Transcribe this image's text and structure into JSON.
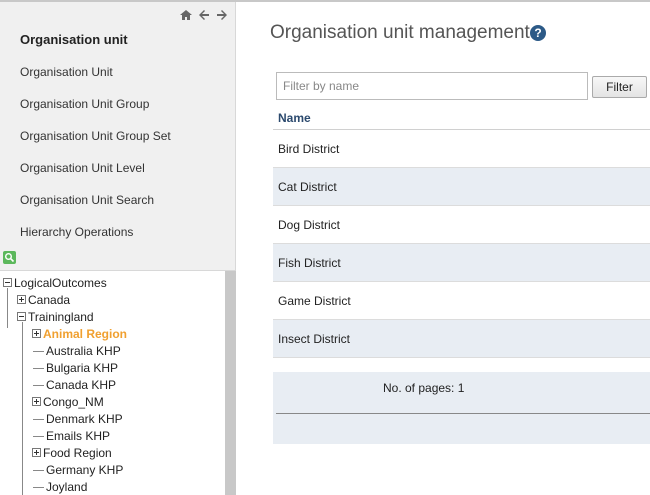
{
  "icons": {
    "home": "home-icon",
    "back": "arrow-left-icon",
    "forward": "arrow-right-icon",
    "search": "search-icon",
    "help": "help-icon"
  },
  "sidebar": {
    "title": "Organisation unit",
    "items": [
      {
        "label": "Organisation Unit"
      },
      {
        "label": "Organisation Unit Group"
      },
      {
        "label": "Organisation Unit Group Set"
      },
      {
        "label": "Organisation Unit Level"
      },
      {
        "label": "Organisation Unit Search"
      },
      {
        "label": "Hierarchy Operations"
      }
    ]
  },
  "tree": {
    "nodes": [
      {
        "label": "LogicalOutcomes",
        "toggle": "minus"
      },
      {
        "label": "Canada",
        "toggle": "plus"
      },
      {
        "label": "Trainingland",
        "toggle": "minus"
      },
      {
        "label": "Animal Region",
        "toggle": "plus",
        "selected": true
      },
      {
        "label": "Australia KHP"
      },
      {
        "label": "Bulgaria KHP"
      },
      {
        "label": "Canada KHP"
      },
      {
        "label": "Congo_NM",
        "toggle": "plus"
      },
      {
        "label": "Denmark KHP"
      },
      {
        "label": "Emails KHP"
      },
      {
        "label": "Food Region",
        "toggle": "plus"
      },
      {
        "label": "Germany KHP"
      },
      {
        "label": "Joyland"
      }
    ]
  },
  "main": {
    "title": "Organisation unit management",
    "help": "?",
    "filter": {
      "placeholder": "Filter by name",
      "button": "Filter"
    },
    "table": {
      "header": "Name",
      "rows": [
        "Bird District",
        "Cat District",
        "Dog District",
        "Fish District",
        "Game District",
        "Insect District"
      ]
    },
    "pager": {
      "text": "No. of pages: 1"
    }
  },
  "colors": {
    "accent": "#f0a030",
    "header_text": "#2c4a6e",
    "row_alt": "#e8edf3",
    "search_green": "#5cb85c"
  }
}
